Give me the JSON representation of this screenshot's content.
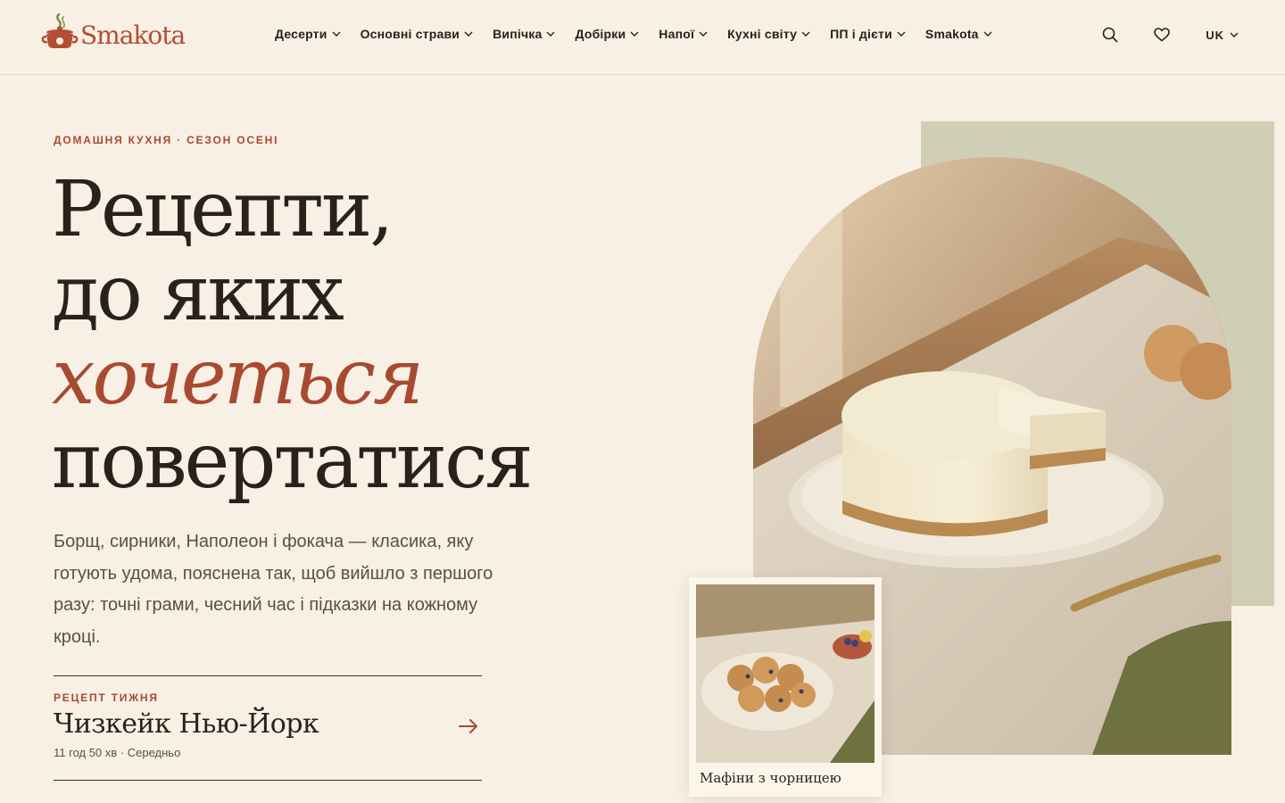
{
  "brand": {
    "name": "Smakota",
    "accent_color": "#a84a31"
  },
  "nav": {
    "items": [
      {
        "label": "Десерти"
      },
      {
        "label": "Основні страви"
      },
      {
        "label": "Випічка"
      },
      {
        "label": "Добірки"
      },
      {
        "label": "Напої"
      },
      {
        "label": "Кухні світу"
      },
      {
        "label": "ПП і дієти"
      },
      {
        "label": "Smakota"
      }
    ]
  },
  "tools": {
    "search_icon": "search-icon",
    "favorites_icon": "heart-icon",
    "language": "UK"
  },
  "hero": {
    "eyebrow": "ДОМАШНЯ КУХНЯ · СЕЗОН ОСЕНІ",
    "headline": {
      "line1": "Рецепти,",
      "line2": "до яких",
      "accent": "хочеться",
      "line4": "повертатися"
    },
    "lead": "Борщ, сирники, Наполеон і фокача — класика, яку готують удома, пояснена так, щоб вийшло з першого разу: точні грами, чесний час і підказки на кожному кроці."
  },
  "recipe_of_week": {
    "label": "РЕЦЕПТ ТИЖНЯ",
    "title": "Чизкейк Нью-Йорк",
    "meta": "11 год 50 хв · Середньо"
  },
  "polaroid": {
    "caption": "Мафіни з чорницею"
  }
}
